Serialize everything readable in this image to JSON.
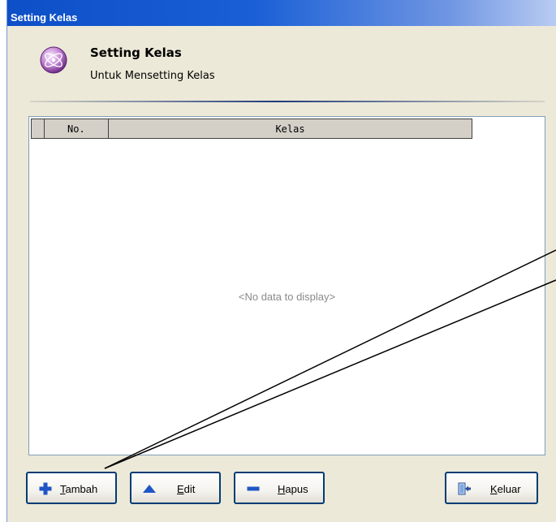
{
  "window": {
    "title": "Setting Kelas"
  },
  "header": {
    "title": "Setting Kelas",
    "subtitle": "Untuk Mensetting Kelas",
    "icon": "orbit-globe-icon"
  },
  "grid": {
    "columns": [
      "No.",
      "Kelas"
    ],
    "rows": [],
    "empty_text": "<No data to display>"
  },
  "buttons": {
    "tambah": {
      "hotkey": "T",
      "rest": "ambah",
      "icon": "plus-icon"
    },
    "edit": {
      "hotkey": "E",
      "rest": "dit",
      "icon": "triangle-up-icon"
    },
    "hapus": {
      "hotkey": "H",
      "rest": "apus",
      "icon": "minus-icon"
    },
    "keluar": {
      "hotkey": "K",
      "rest": "eluar",
      "icon": "exit-door-icon"
    }
  },
  "colors": {
    "title_bar": "#0d4fc7",
    "icon_blue": "#1f56c6",
    "window_bg": "#ece9d8"
  }
}
